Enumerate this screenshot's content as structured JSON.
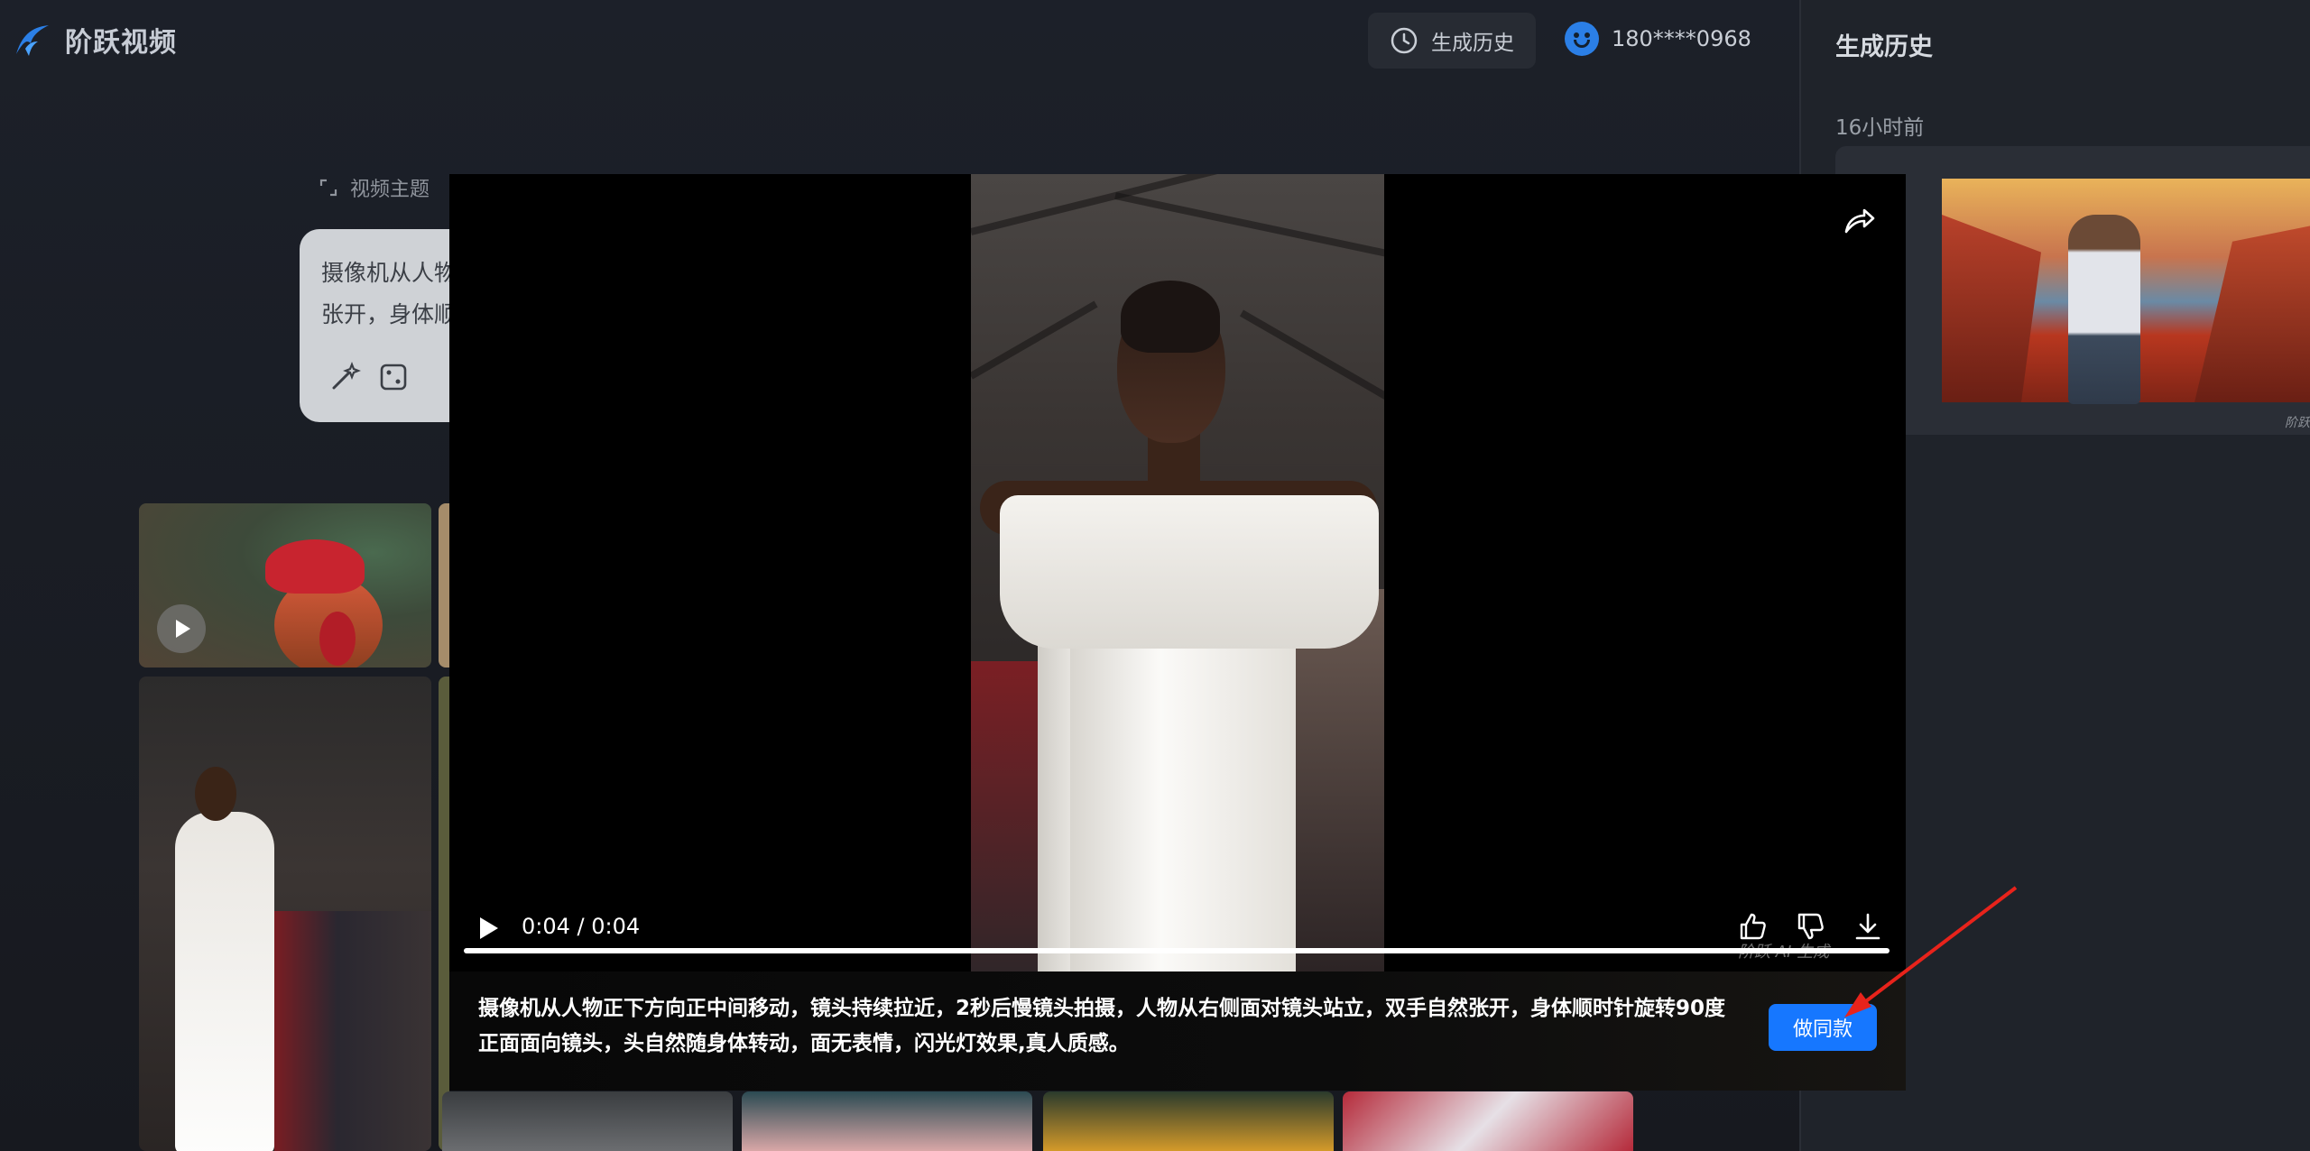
{
  "app": {
    "name": "阶跃视频"
  },
  "header": {
    "history_label": "生成历史",
    "user_phone": "180****0968"
  },
  "main": {
    "topic_label": "视频主题",
    "prompt_line1": "摄像机从人物",
    "prompt_line2": "张开，身体顺"
  },
  "panel": {
    "title": "生成历史",
    "time": "16小时前",
    "watermark": "阶跃"
  },
  "modal": {
    "time_display": "0:04 / 0:04",
    "watermark": "阶跃 AI 生成",
    "caption": "摄像机从人物正下方向正中间移动，镜头持续拉近，2秒后慢镜头拍摄，人物从右侧面对镜头站立，双手自然张开，身体顺时针旋转90度正面面向镜头，头自然随身体转动，面无表情，闪光灯效果,真人质感。",
    "same_button": "做同款",
    "progress": 1.0
  },
  "colors": {
    "accent": "#1677ff",
    "annotation_arrow": "#e8231b"
  },
  "icons": [
    "logo-icon",
    "clock-icon",
    "avatar-icon",
    "expand-icon",
    "magic-wand-icon",
    "dice-icon",
    "share-icon",
    "play-icon",
    "thumbs-up-icon",
    "thumbs-down-icon",
    "download-icon"
  ]
}
